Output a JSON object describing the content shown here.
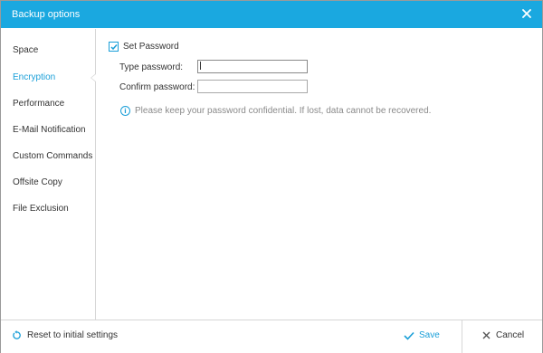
{
  "window": {
    "title": "Backup options"
  },
  "sidebar": {
    "items": [
      {
        "label": "Space",
        "active": false
      },
      {
        "label": "Encryption",
        "active": true
      },
      {
        "label": "Performance",
        "active": false
      },
      {
        "label": "E-Mail Notification",
        "active": false
      },
      {
        "label": "Custom Commands",
        "active": false
      },
      {
        "label": "Offsite Copy",
        "active": false
      },
      {
        "label": "File Exclusion",
        "active": false
      }
    ]
  },
  "encryption": {
    "set_password_label": "Set Password",
    "set_password_checked": true,
    "type_password_label": "Type password:",
    "type_password_value": "",
    "confirm_password_label": "Confirm password:",
    "confirm_password_value": "",
    "info_text": "Please keep your password confidential. If lost, data cannot be recovered."
  },
  "footer": {
    "reset_label": "Reset to initial settings",
    "save_label": "Save",
    "cancel_label": "Cancel"
  },
  "colors": {
    "titlebar": "#1aa8e0",
    "accent": "#1a9fd8",
    "border": "#d6d6d6",
    "text": "#333333",
    "muted_text": "#8a8a8a"
  }
}
